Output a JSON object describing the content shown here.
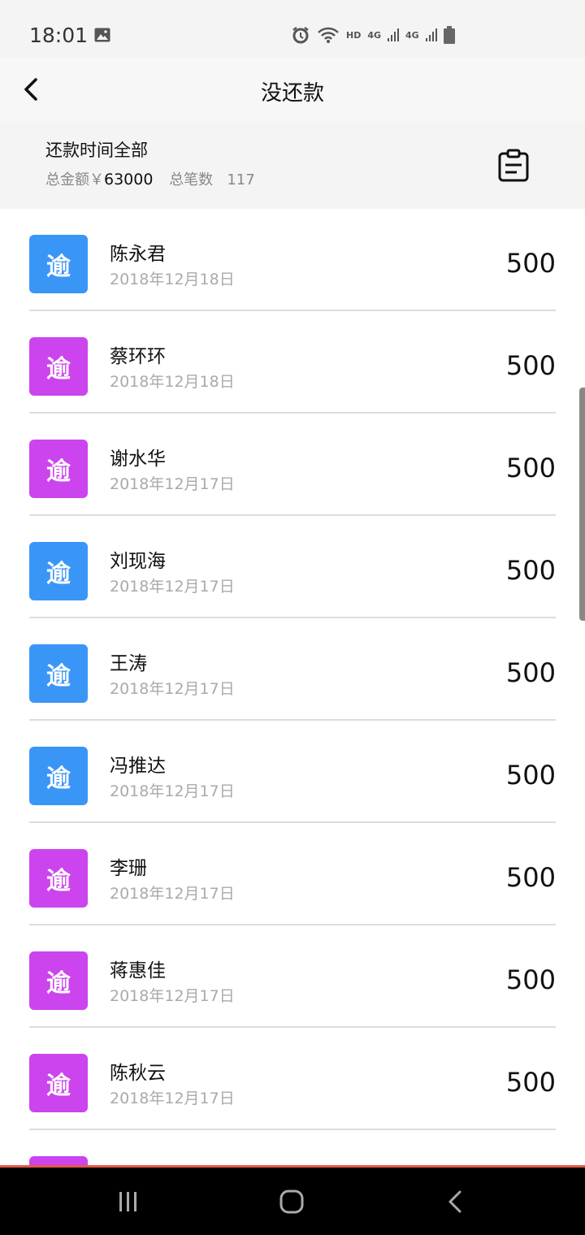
{
  "status_bar": {
    "time": "18:01",
    "hd": "HD",
    "net1": "4G",
    "net2": "4G",
    "icons": [
      "image-icon",
      "alarm-icon",
      "wifi-icon",
      "signal-icon",
      "battery-icon"
    ]
  },
  "header": {
    "title": "没还款",
    "back_icon": "chevron-left-icon"
  },
  "summary": {
    "title": "还款时间全部",
    "total_amount_label": "总金额￥",
    "total_amount_value": "63000",
    "total_count_label": "总笔数",
    "total_count_value": "117",
    "calendar_icon": "clipboard-icon"
  },
  "badge_label": "逾",
  "colors": {
    "badge_blue": "#3a96f6",
    "badge_purple": "#cc44ee",
    "accent": "#e05a47"
  },
  "records": [
    {
      "name": "陈永君",
      "date": "2018年12月18日",
      "amount": "500",
      "badge": "blue"
    },
    {
      "name": "蔡环环",
      "date": "2018年12月18日",
      "amount": "500",
      "badge": "purple"
    },
    {
      "name": "谢水华",
      "date": "2018年12月17日",
      "amount": "500",
      "badge": "purple"
    },
    {
      "name": "刘现海",
      "date": "2018年12月17日",
      "amount": "500",
      "badge": "blue"
    },
    {
      "name": "王涛",
      "date": "2018年12月17日",
      "amount": "500",
      "badge": "blue"
    },
    {
      "name": "冯推达",
      "date": "2018年12月17日",
      "amount": "500",
      "badge": "blue"
    },
    {
      "name": "李珊",
      "date": "2018年12月17日",
      "amount": "500",
      "badge": "purple"
    },
    {
      "name": "蒋惠佳",
      "date": "2018年12月17日",
      "amount": "500",
      "badge": "purple"
    },
    {
      "name": "陈秋云",
      "date": "2018年12月17日",
      "amount": "500",
      "badge": "purple"
    },
    {
      "name": "",
      "date": "",
      "amount": "",
      "badge": "purple"
    }
  ],
  "nav": [
    "recents-icon",
    "home-icon",
    "back-icon"
  ]
}
